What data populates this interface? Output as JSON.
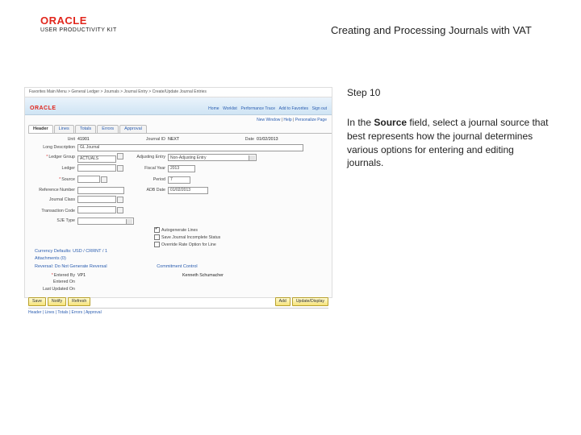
{
  "brand": {
    "name": "ORACLE",
    "sub": "USER PRODUCTIVITY KIT"
  },
  "page_title": "Creating and Processing Journals with VAT",
  "step": {
    "label": "Step 10",
    "body_pre": "In the ",
    "body_bold": "Source",
    "body_post": " field, select a journal source that best represents how the journal determines various options for entering and editing journals."
  },
  "app": {
    "crumbs_left": "Favorites  Main Menu > General Ledger > Journals > Journal Entry > Create/Update Journal Entries",
    "crumbs_right": [
      "Home",
      "Worklist",
      "Performance Trace",
      "Add to Favorites",
      "Sign out"
    ],
    "logo": "ORACLE",
    "subhdr_links": [
      "New Window",
      "Help",
      "Personalize Page"
    ],
    "tabs": [
      "Header",
      "Lines",
      "Totals",
      "Errors",
      "Approval"
    ],
    "fields": {
      "unit_label": "Unit",
      "unit_value": "41901",
      "jid_label": "Journal ID",
      "jid_value": "NEXT",
      "date_label": "Date",
      "date_value": "01/02/2013",
      "longdesc_label": "Long Description",
      "longdesc_value": "GL Journal",
      "ledgergrp_label": "Ledger Group",
      "ledgergrp_value": "ACTUALS",
      "adjent_label": "Adjusting Entry",
      "adjent_value": "Non-Adjusting Entry",
      "ledger_label": "Ledger",
      "fy_label": "Fiscal Year",
      "fy_value": "2013",
      "source_label": "Source",
      "source_value": "",
      "period_label": "Period",
      "period_value": "7",
      "refno_label": "Reference Number",
      "adbdate_label": "ADB Date",
      "adbdate_value": "01/02/2013",
      "jclass_label": "Journal Class",
      "txncode_label": "Transaction Code",
      "sjetype_label": "SJE Type",
      "chk_autogen": "Autogenerate Lines",
      "chk_savecomp": "Save Journal Incomplete Status",
      "chk_rate": "Override Rate Option for Line",
      "cur_section": "Currency Defaults: USD / CRRNT / 1",
      "attach_link": "Attachments (0)",
      "rev_section": "Reversal: Do Not Generate Reversal",
      "comm_link": "Commitment Control",
      "entby_label": "Entered By",
      "entby_value": "VP1",
      "enton_label": "Entered On",
      "upd_label": "Last Updated On",
      "key_value": "Kenneth Schumacher"
    },
    "btns": {
      "save": "Save",
      "notify": "Notify",
      "refresh": "Refresh",
      "add": "Add",
      "updatedisp": "Update/Display"
    },
    "line_tabs": "Header | Lines | Totals | Errors | Approval"
  }
}
